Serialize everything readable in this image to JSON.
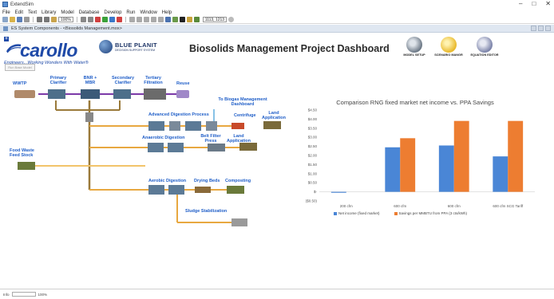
{
  "window": {
    "title": "ExtendSim",
    "controls": [
      "–",
      "□",
      "✕"
    ]
  },
  "menu": [
    "File",
    "Edit",
    "Text",
    "Library",
    "Model",
    "Database",
    "Develop",
    "Run",
    "Window",
    "Help"
  ],
  "toolbar": {
    "zoom": "100%",
    "coords": "1113, 1213"
  },
  "tab": {
    "label": "ES System Components - <Biosolids Management.mox>"
  },
  "header": {
    "company_logo": "carollo",
    "tagline": "Engineers...Working Wonders With Water®",
    "partner_logo": "BLUE PLANIT",
    "partner_sub": "DECISION SUPPORT SYSTEM",
    "title": "Biosolids Management Project Dashboard",
    "run_button": "Run Base Model"
  },
  "nav": [
    {
      "label": "MODEL SETUP",
      "icon": "model-setup-icon",
      "color": "#6b7785"
    },
    {
      "label": "SCENARIO MANGR",
      "icon": "scenario-manager-icon",
      "color": "#e8b82a"
    },
    {
      "label": "EQUATION EDITOR",
      "icon": "equation-editor-icon",
      "color": "#7a82a8"
    }
  ],
  "flow": {
    "wwtp": "WWTP",
    "primary": "Primary Clarifier",
    "bnr": "BNR + MBR",
    "secondary": "Secondary Clarifier",
    "tertiary": "Tertiary Filtration",
    "reuse": "Reuse",
    "biogas": "To Biogas Management Dashboard",
    "adv_digestion": "Advanced Digestion Process",
    "centrifuge": "Centrifuge",
    "land_app_1": "Land Application",
    "anaerobic": "Anaerobic Digestion",
    "belt_filter": "Belt Filter Press",
    "land_app_2": "Land Application",
    "food_waste": "Food Waste Feed Stock",
    "aerobic": "Aerobic Digestion",
    "drying_beds": "Drying Beds",
    "composting": "Composting",
    "sludge_stab": "Sludge Stabilization"
  },
  "chart_data": {
    "type": "bar",
    "title": "Comparison RNG fixed market net income vs. PPA Savings",
    "categories": [
      "200 cfm",
      "600 cfm",
      "600 cfm",
      "600 cfm SCG Tariff"
    ],
    "series": [
      {
        "name": "Net income (fixed market)",
        "color": "#4a86d6",
        "values": [
          -0.05,
          2.45,
          2.55,
          1.95
        ]
      },
      {
        "name": "Savings per MMBTU from PPA (3 cts/kWh)",
        "color": "#ed7d31",
        "values": [
          0,
          2.95,
          3.9,
          3.9
        ]
      }
    ],
    "yticks": [
      "$4.50",
      "$4.00",
      "$3.50",
      "$3.00",
      "$2.50",
      "$2.00",
      "$1.50",
      "$1.00",
      "$0.50",
      "$-",
      "($0.50)"
    ],
    "ylim": [
      -0.5,
      4.5
    ],
    "legend": "bottom",
    "grid": false
  },
  "status": {
    "zoom_label": "100%"
  }
}
